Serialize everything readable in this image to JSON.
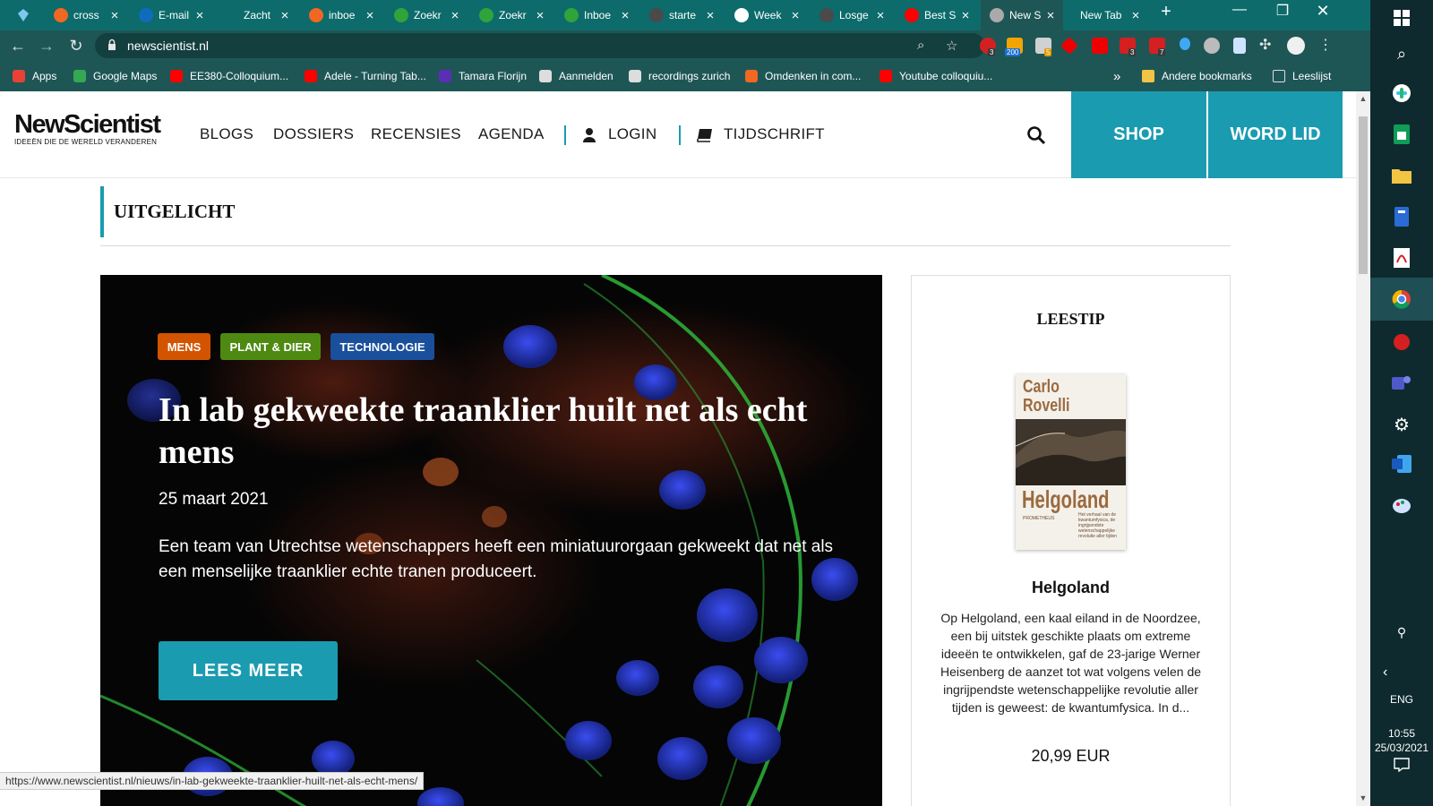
{
  "browser": {
    "tabs": [
      {
        "label": "cross",
        "color": "#f26722"
      },
      {
        "label": "E-mail",
        "color": "#0f6cbd"
      },
      {
        "label": "Zacht",
        "color": "#0d6b6b"
      },
      {
        "label": "inboe",
        "color": "#f26722"
      },
      {
        "label": "Zoekr",
        "color": "#2fa43a"
      },
      {
        "label": "Zoekr",
        "color": "#2fa43a"
      },
      {
        "label": "Inboe",
        "color": "#2fa43a"
      },
      {
        "label": "starte",
        "color": "#4a4a4a"
      },
      {
        "label": "Week",
        "color": "#ffffff"
      },
      {
        "label": "Losge",
        "color": "#4a4a4a"
      },
      {
        "label": "Best S",
        "color": "#ff0000"
      },
      {
        "label": "New S",
        "color": "#aaaaaa",
        "active": true
      },
      {
        "label": "New Tab",
        "color": ""
      }
    ],
    "new_tab": "+",
    "url": "newscientist.nl",
    "extension_badges": [
      "3",
      "200",
      "5",
      "3",
      "7"
    ],
    "bookmarks": [
      {
        "label": "Apps",
        "color": "#e94235"
      },
      {
        "label": "Google Maps",
        "color": "#34a853"
      },
      {
        "label": "EE380-Colloquium...",
        "color": "#ff0000"
      },
      {
        "label": "Adele - Turning Tab...",
        "color": "#ff0000"
      },
      {
        "label": "Tamara Florijn",
        "color": "#5b2fb3"
      },
      {
        "label": "Aanmelden",
        "color": "#dddddd"
      },
      {
        "label": "recordings zurich",
        "color": "#dddddd"
      },
      {
        "label": "Omdenken in com...",
        "color": "#f26722"
      },
      {
        "label": "Youtube colloquiu...",
        "color": "#ff0000"
      }
    ],
    "bookmarks_overflow": "»",
    "other_bookmarks": "Andere bookmarks",
    "reading_list": "Leeslijst"
  },
  "site": {
    "logo_text": "NewScientist",
    "logo_tagline": "IDEEËN DIE DE WERELD VERANDEREN",
    "nav": [
      "BLOGS",
      "DOSSIERS",
      "RECENSIES",
      "AGENDA"
    ],
    "login": "LOGIN",
    "magazine": "TIJDSCHRIFT",
    "shop": "SHOP",
    "join": "WORD LID",
    "accent_color": "#1a9bb0"
  },
  "section_title": "UITGELICHT",
  "hero": {
    "tags": [
      {
        "label": "MENS",
        "color": "#d35400"
      },
      {
        "label": "PLANT & DIER",
        "color": "#4e8a12"
      },
      {
        "label": "TECHNOLOGIE",
        "color": "#1a4f9c"
      }
    ],
    "title": "In lab gekweekte traanklier huilt net als echt mens",
    "date": "25 maart 2021",
    "excerpt": "Een team van Utrechtse wetenschappers heeft een miniatuurorgaan gekweekt dat net als een menselijke traanklier echte tranen produceert.",
    "cta": "LEES MEER"
  },
  "tip": {
    "heading": "LEESTIP",
    "cover_author": "Carlo Rovelli",
    "cover_title": "Helgoland",
    "cover_subtitle": "Het verhaal van de kwantumfysica, de ingrijpendste wetenschappelijke revolutie aller tijden",
    "cover_publisher": "PROMETHEUS",
    "book_title": "Helgoland",
    "description": "Op Helgoland, een kaal eiland in de Noordzee, een bij uitstek geschikte plaats om extreme ideeën te ontwikkelen, gaf de 23-jarige Werner Heisenberg de aanzet tot wat volgens velen de ingrijpendste wetenschappelijke revolutie aller tijden is geweest: de kwantumfysica. In d...",
    "price": "20,99 EUR"
  },
  "status_url": "https://www.newscientist.nl/nieuws/in-lab-gekweekte-traanklier-huilt-net-als-echt-mens/",
  "taskbar": {
    "language": "ENG",
    "time": "10:55",
    "date": "25/03/2021"
  }
}
